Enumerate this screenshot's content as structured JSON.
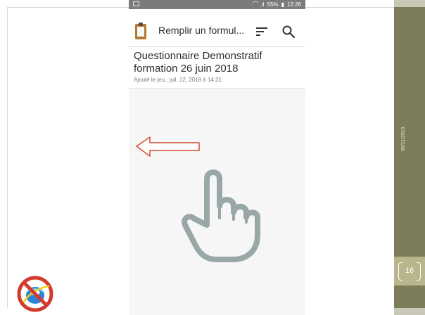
{
  "slide": {
    "date": "06/11/2019",
    "page_number": "16"
  },
  "phone": {
    "status_bar": {
      "time": "12:26",
      "battery": "55%",
      "signal": "wifi-signal-icon"
    },
    "app_bar": {
      "title": "Remplir un formul..."
    },
    "form": {
      "title": "Questionnaire Demonstratif formation 26 juin 2018",
      "added": "Ajouté le jeu., juil. 12, 2018 à 14:31"
    }
  },
  "icons": {
    "clipboard": "clipboard-icon",
    "sort": "sort-icon",
    "search": "search-icon",
    "arrow": "left-arrow-icon",
    "hand": "pointing-hand-icon",
    "no_ie": "no-internet-explorer-icon"
  },
  "colors": {
    "accent": "#7d7c59",
    "arrow": "#d34b2f",
    "hand": "#9aa7a8",
    "prohibition": "#d23a2d",
    "ie_blue": "#2a83d8"
  }
}
